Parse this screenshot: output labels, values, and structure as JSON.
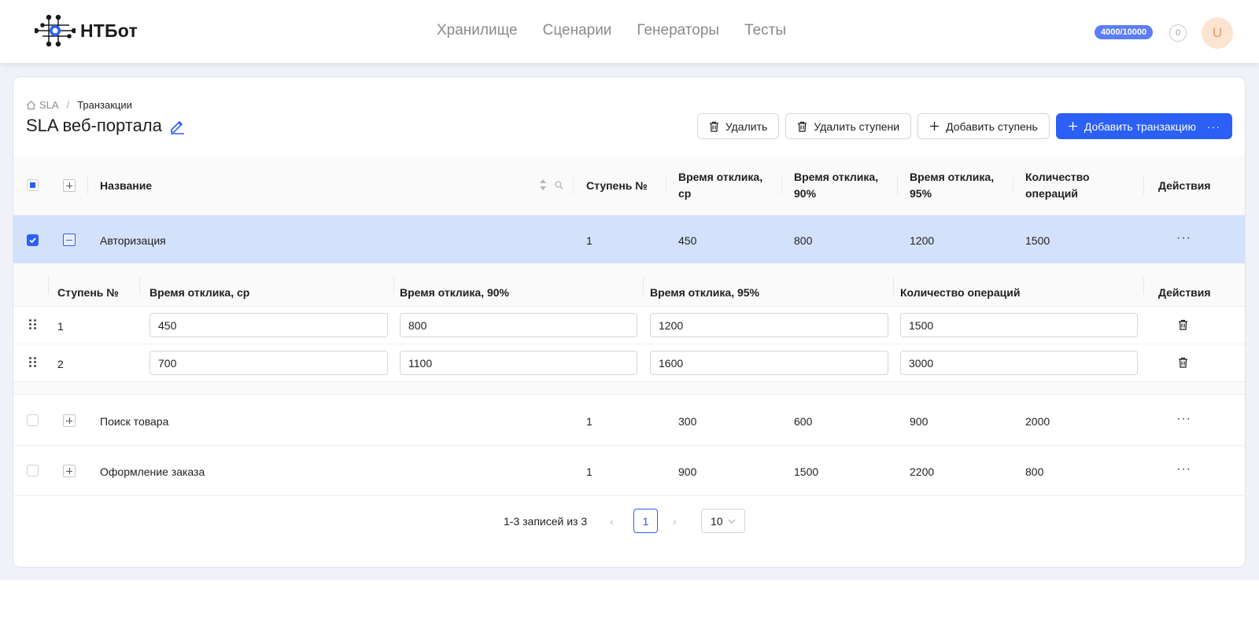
{
  "header": {
    "logo_text": "НТБот",
    "nav": [
      "Хранилище",
      "Сценарии",
      "Генераторы",
      "Тесты"
    ],
    "quota": "4000/10000",
    "notifications": "0",
    "avatar": "U"
  },
  "breadcrumb": {
    "root": "SLA",
    "separator": "/",
    "current": "Транзакции"
  },
  "page_title": "SLA веб-портала",
  "actions": {
    "delete": "Удалить",
    "delete_steps": "Удалить ступени",
    "add_step": "Добавить ступень",
    "add_transaction": "Добавить транзакцию"
  },
  "table": {
    "headers": {
      "name": "Название",
      "step": "Ступень №",
      "resp_avg_1": "Время отклика,",
      "resp_avg_2": "ср",
      "resp_90_1": "Время отклика,",
      "resp_90_2": "90%",
      "resp_95_1": "Время отклика,",
      "resp_95_2": "95%",
      "ops_1": "Количество",
      "ops_2": "операций",
      "actions": "Действия"
    },
    "rows": [
      {
        "name": "Авторизация",
        "step": "1",
        "avg": "450",
        "p90": "800",
        "p95": "1200",
        "ops": "1500"
      },
      {
        "name": "Поиск товара",
        "step": "1",
        "avg": "300",
        "p90": "600",
        "p95": "900",
        "ops": "2000"
      },
      {
        "name": "Оформление заказа",
        "step": "1",
        "avg": "900",
        "p90": "1500",
        "p95": "2200",
        "ops": "800"
      }
    ]
  },
  "nested": {
    "headers": {
      "step": "Ступень №",
      "avg": "Время отклика, ср",
      "p90": "Время отклика, 90%",
      "p95": "Время отклика, 95%",
      "ops": "Количество операций",
      "actions": "Действия"
    },
    "rows": [
      {
        "step": "1",
        "avg": "450",
        "p90": "800",
        "p95": "1200",
        "ops": "1500"
      },
      {
        "step": "2",
        "avg": "700",
        "p90": "1100",
        "p95": "1600",
        "ops": "3000"
      }
    ]
  },
  "pagination": {
    "summary": "1-3 записей из 3",
    "page": "1",
    "page_size": "10"
  },
  "colors": {
    "primary": "#2b5ff5",
    "selected_row": "#d4e1fb",
    "quota_badge": "#5b7df5"
  }
}
